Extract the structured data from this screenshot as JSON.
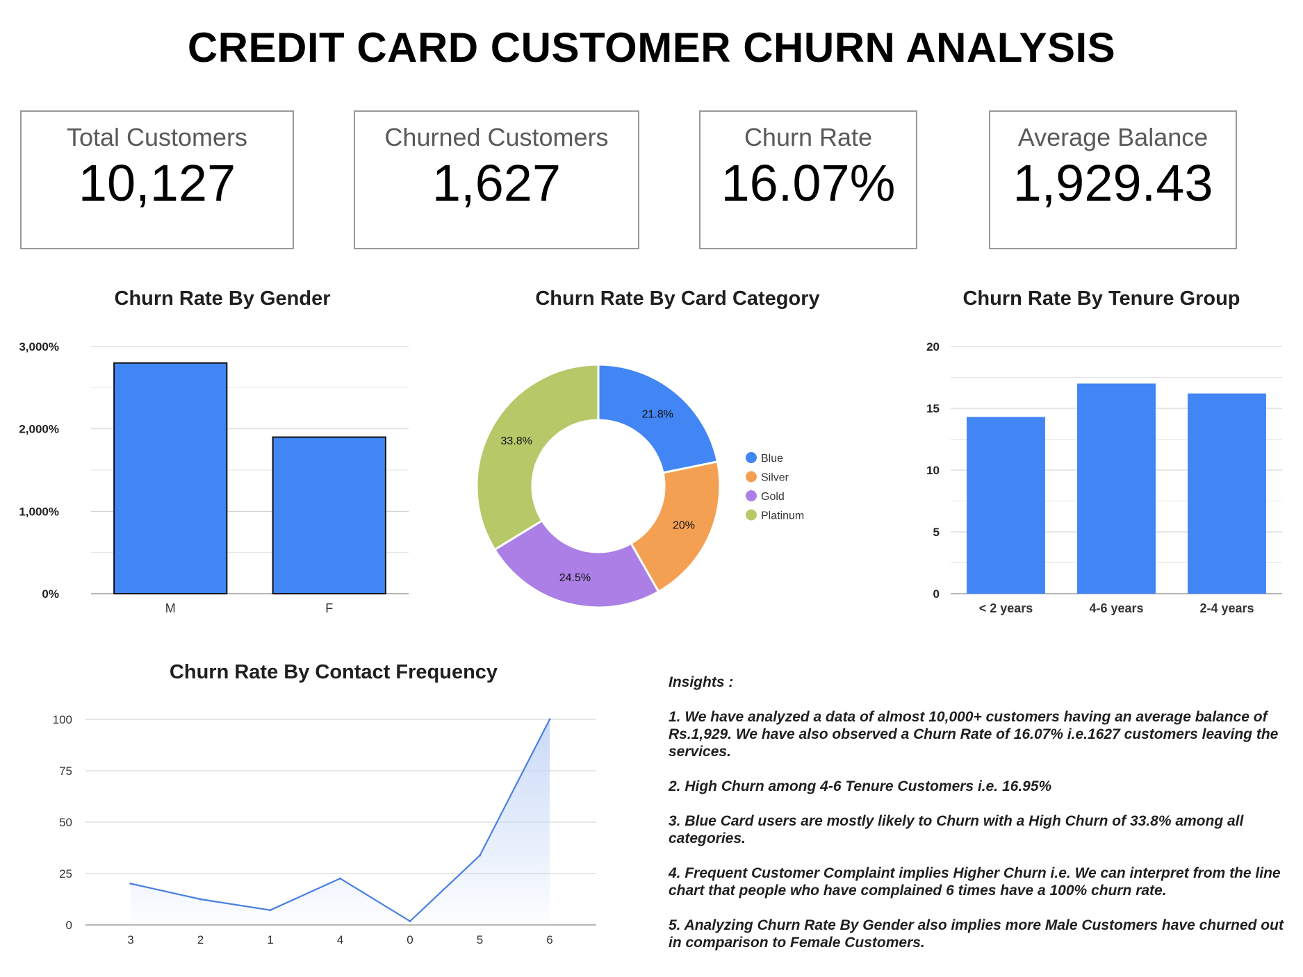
{
  "title": "CREDIT CARD CUSTOMER CHURN ANALYSIS",
  "kpis": [
    {
      "label": "Total Customers",
      "value": "10,127"
    },
    {
      "label": "Churned Customers",
      "value": "1,627"
    },
    {
      "label": "Churn Rate",
      "value": "16.07%"
    },
    {
      "label": "Average Balance",
      "value": "1,929.43"
    }
  ],
  "chart_data": [
    {
      "type": "bar",
      "title": "Churn Rate By Gender",
      "categories": [
        "M",
        "F"
      ],
      "values": [
        2800,
        1900
      ],
      "yticks": [
        "0%",
        "1,000%",
        "2,000%",
        "3,000%"
      ],
      "ylim": [
        0,
        3000
      ],
      "grid": true,
      "color": "#4285f4"
    },
    {
      "type": "pie",
      "title": "Churn Rate By Card Category",
      "donut": true,
      "labels": [
        "Blue",
        "Silver",
        "Gold",
        "Platinum"
      ],
      "values": [
        21.8,
        20,
        24.5,
        33.8
      ],
      "slice_labels": [
        "21.8%",
        "20%",
        "24.5%",
        "33.8%"
      ],
      "colors": [
        "#4285f4",
        "#f4a052",
        "#ab7fe5",
        "#b6c868"
      ],
      "legend": "right"
    },
    {
      "type": "bar",
      "title": "Churn Rate By Tenure Group",
      "categories": [
        "< 2 years",
        "4-6 years",
        "2-4 years"
      ],
      "values": [
        14.3,
        17.0,
        16.2
      ],
      "yticks": [
        "0",
        "5",
        "10",
        "15",
        "20"
      ],
      "ylim": [
        0,
        20
      ],
      "grid": true,
      "color": "#4285f4"
    },
    {
      "type": "area",
      "title": "Churn Rate By Contact Frequency",
      "categories": [
        "3",
        "2",
        "1",
        "4",
        "0",
        "5",
        "6"
      ],
      "values": [
        20.1,
        12.5,
        7.2,
        22.6,
        1.8,
        33.8,
        100
      ],
      "yticks": [
        "0",
        "25",
        "50",
        "75",
        "100"
      ],
      "ylim": [
        0,
        100
      ],
      "grid": true,
      "color": "#4a7fe0"
    }
  ],
  "insights": {
    "heading": "Insights :",
    "items": [
      "1. We have analyzed a data of almost 10,000+ customers having an average balance of Rs.1,929. We have also observed a Churn Rate of 16.07% i.e.1627 customers leaving the services.",
      "2.  High Churn among 4-6 Tenure Customers i.e. 16.95%",
      "3. Blue Card users are mostly likely to Churn with a High Churn of 33.8% among all categories.",
      "4. Frequent Customer Complaint implies Higher Churn i.e. We can interpret from the line chart that people who have complained 6 times have a 100% churn rate.",
      "5. Analyzing Churn Rate By Gender also implies more Male Customers have churned out in comparison to Female Customers."
    ]
  }
}
